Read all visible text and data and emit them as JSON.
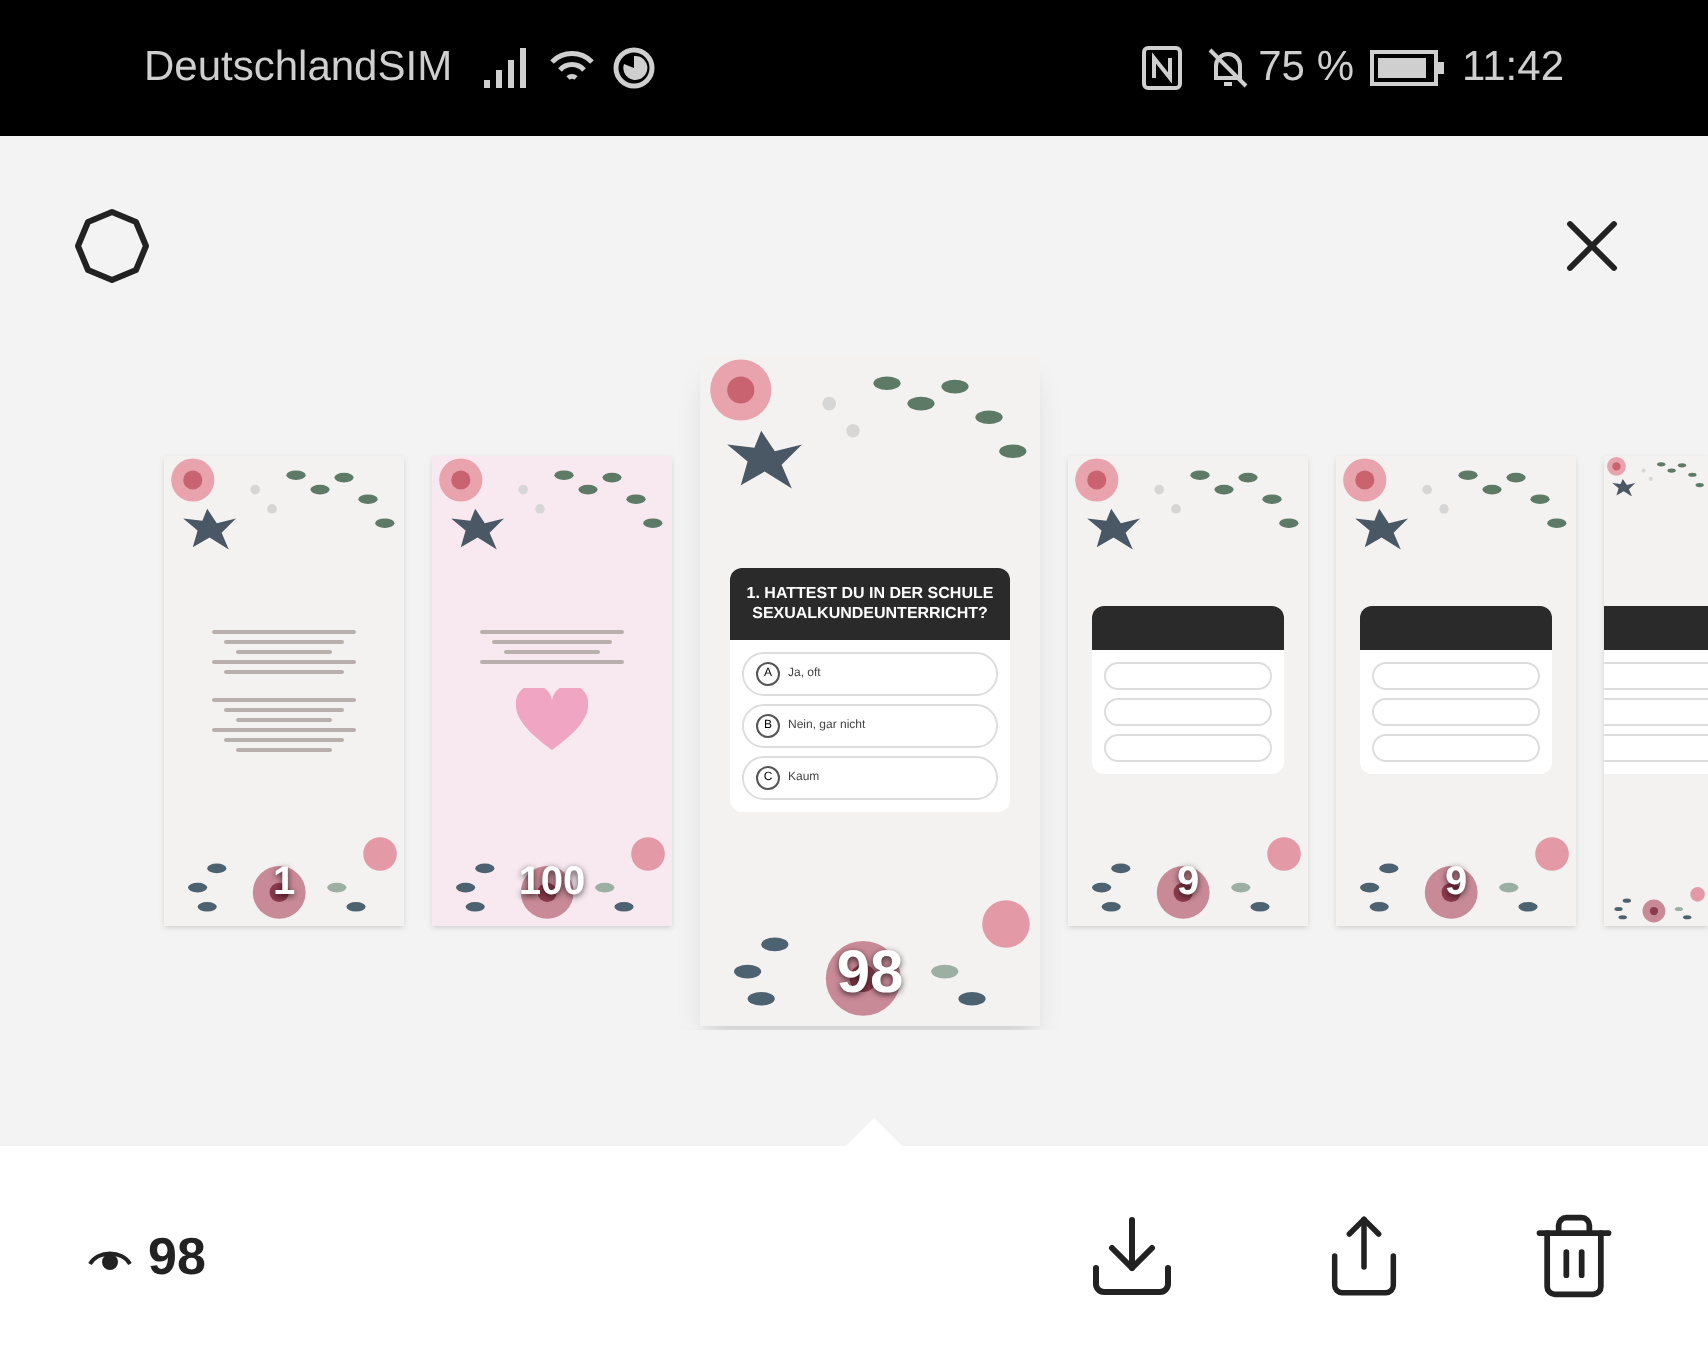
{
  "status_bar": {
    "carrier": "DeutschlandSIM",
    "battery": "75 %",
    "time": "11:42"
  },
  "stories": [
    {
      "kind": "text",
      "selected": false,
      "count": "1"
    },
    {
      "kind": "thanks",
      "selected": false,
      "count": "100"
    },
    {
      "kind": "poll",
      "selected": true,
      "count": "98",
      "question": "1. HATTEST DU IN DER SCHULE SEXUALKUNDEUNTERRICHT?",
      "options": [
        {
          "letter": "A",
          "text": "Ja, oft"
        },
        {
          "letter": "B",
          "text": "Nein, gar nicht"
        },
        {
          "letter": "C",
          "text": "Kaum"
        }
      ]
    },
    {
      "kind": "poll",
      "selected": false,
      "count": "9"
    },
    {
      "kind": "poll",
      "selected": false,
      "count": "9"
    },
    {
      "kind": "poll",
      "selected": false
    }
  ],
  "footer": {
    "views": "98"
  }
}
